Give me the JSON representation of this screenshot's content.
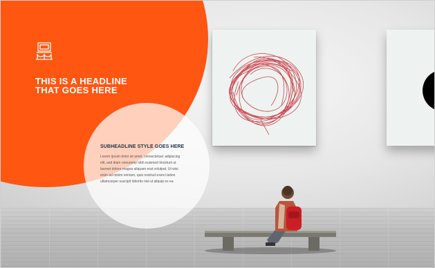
{
  "hero": {
    "headline_lines": [
      "THIS IS A HEADLINE",
      "THAT GOES HERE"
    ],
    "icon": "museum-exhibit-icon"
  },
  "content": {
    "subheadline": "SUBHEADLINE STYLE GOES HERE",
    "body_lines": [
      "Lorem ipsum dolor sit amet, consectetuer adipiscing",
      "elit, sed diam nonummy nibh euismod tincidunt ut",
      "laoreet dolore magna aliquam erat volutpat. Ut wisi",
      "enim ad minim veniam, quis nostrud exerci tation",
      "ullamcorper suscipit lobortis nisl ut aliquip ex ea"
    ]
  },
  "colors": {
    "accent": "#ff5611",
    "subheadline": "#1f3346",
    "scribble": "#c8323c"
  }
}
